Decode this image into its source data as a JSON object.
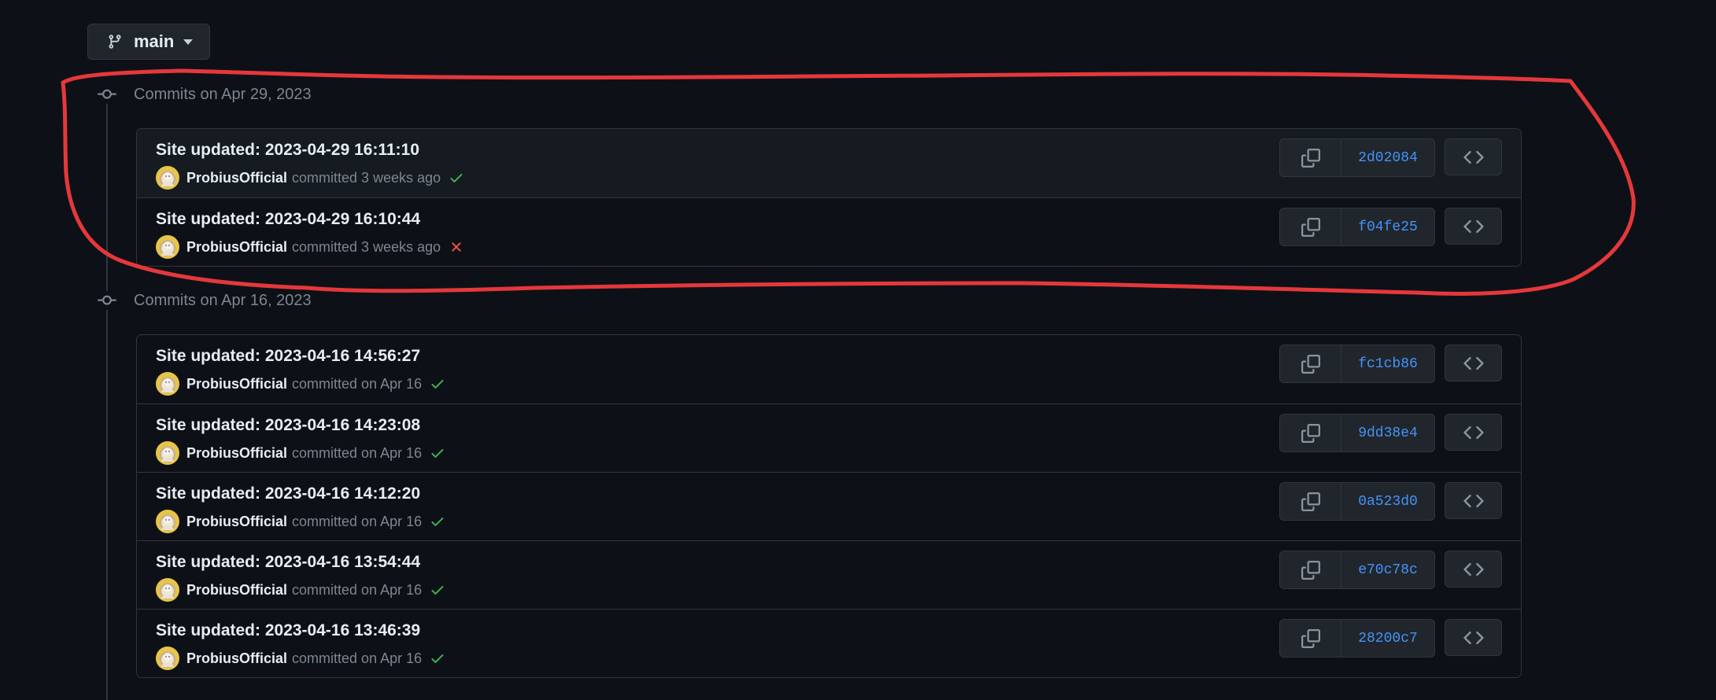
{
  "branch": {
    "name": "main",
    "icon": "git-branch-icon"
  },
  "groups": [
    {
      "heading": "Commits on Apr 29, 2023",
      "commits": [
        {
          "title": "Site updated: 2023-04-29 16:11:10",
          "author": "ProbiusOfficial",
          "when": "committed 3 weeks ago",
          "status": "success",
          "sha": "2d02084"
        },
        {
          "title": "Site updated: 2023-04-29 16:10:44",
          "author": "ProbiusOfficial",
          "when": "committed 3 weeks ago",
          "status": "failure",
          "sha": "f04fe25"
        }
      ]
    },
    {
      "heading": "Commits on Apr 16, 2023",
      "commits": [
        {
          "title": "Site updated: 2023-04-16 14:56:27",
          "author": "ProbiusOfficial",
          "when": "committed on Apr 16",
          "status": "success",
          "sha": "fc1cb86"
        },
        {
          "title": "Site updated: 2023-04-16 14:23:08",
          "author": "ProbiusOfficial",
          "when": "committed on Apr 16",
          "status": "success",
          "sha": "9dd38e4"
        },
        {
          "title": "Site updated: 2023-04-16 14:12:20",
          "author": "ProbiusOfficial",
          "when": "committed on Apr 16",
          "status": "success",
          "sha": "0a523d0"
        },
        {
          "title": "Site updated: 2023-04-16 13:54:44",
          "author": "ProbiusOfficial",
          "when": "committed on Apr 16",
          "status": "success",
          "sha": "e70c78c"
        },
        {
          "title": "Site updated: 2023-04-16 13:46:39",
          "author": "ProbiusOfficial",
          "when": "committed on Apr 16",
          "status": "success",
          "sha": "28200c7"
        }
      ]
    }
  ],
  "colors": {
    "background": "#0d1117",
    "border": "#30363d",
    "link": "#4493f8",
    "success": "#3fb950",
    "failure": "#f85149",
    "annotation": "#e5383b"
  }
}
